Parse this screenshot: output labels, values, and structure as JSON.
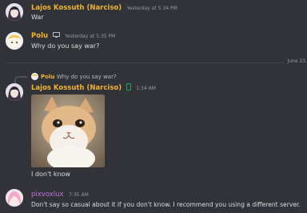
{
  "colors": {
    "background": "#313338",
    "kossuth_name": "#f0b232",
    "polu_name": "#f0b232",
    "pixvoxlux_name": "#c271d9",
    "timestamp": "#949ba4",
    "text": "#dbdee1"
  },
  "messages": [
    {
      "author": "Lajos Kossuth (Narciso)",
      "timestamp": "Yesterday at 5:34 PM",
      "text": "War"
    },
    {
      "author": "Polu",
      "device_icon": "monitor-icon",
      "timestamp": "Yesterday at 5:35 PM",
      "text": "Why do you say war?"
    },
    {
      "reply_to": {
        "author": "Polu",
        "text": "Why do you say war?"
      },
      "author": "Lajos Kossuth (Narciso)",
      "device_icon": "mobile-phone-icon",
      "timestamp": "1:34 AM",
      "attachment": "cat-image",
      "text": "I don't know"
    },
    {
      "author": "pixvoxlux",
      "timestamp": "7:35 AM",
      "text": "Don't say so casual about it if you don't know. I recommend you using a different server."
    }
  ],
  "date_divider": "June 23,"
}
